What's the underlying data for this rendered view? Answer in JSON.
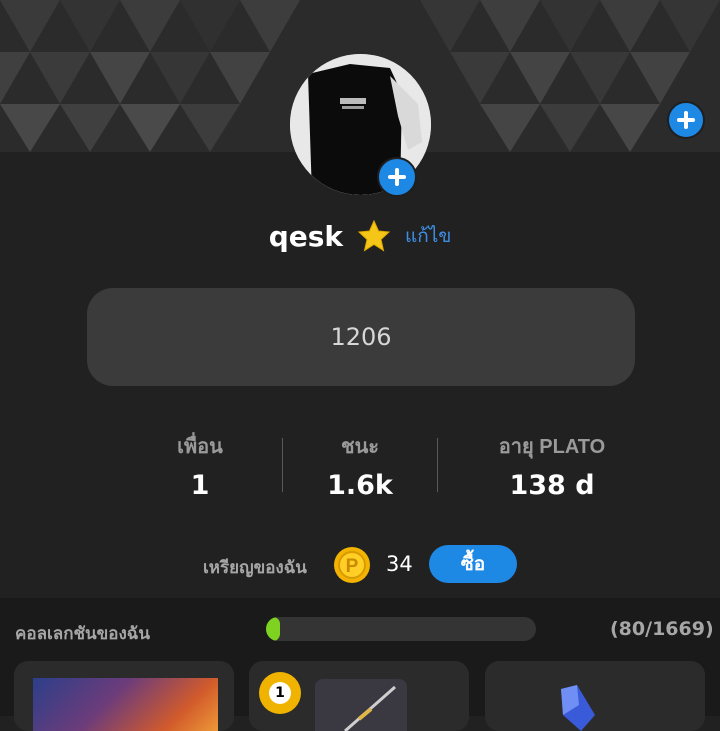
{
  "profile": {
    "username": "qesk",
    "edit_label": "แก้ไข",
    "status_number": "1206"
  },
  "stats": [
    {
      "label": "เพื่อน",
      "value": "1"
    },
    {
      "label": "ชนะ",
      "value": "1.6k"
    },
    {
      "label": "อายุ PLATO",
      "value": "138 d"
    }
  ],
  "coins": {
    "label": "เหรียญของฉัน",
    "count": "34",
    "buy_label": "ซื้อ",
    "coin_symbol": "P"
  },
  "collection": {
    "label": "คอลเลกชันของฉัน",
    "progress_text": "(80/1669)",
    "progress_fraction": 0.048
  },
  "cards": {
    "ball_number": "1"
  },
  "colors": {
    "accent": "#1e88e5",
    "progress": "#7ed321",
    "coin": "#f2b400"
  }
}
